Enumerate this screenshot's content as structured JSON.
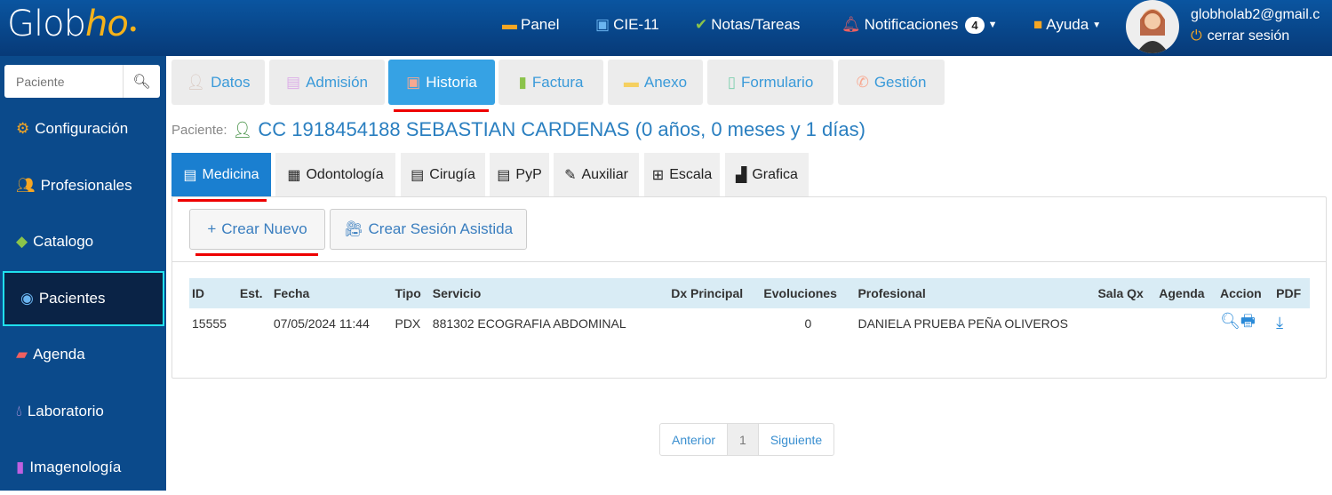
{
  "header": {
    "logo_main": "Glob",
    "logo_accent": "ho",
    "nav": [
      {
        "label": "Panel",
        "icon": "monitor-icon"
      },
      {
        "label": "CIE-11",
        "icon": "cie-icon"
      },
      {
        "label": "Notas/Tareas",
        "icon": "check-circle-icon"
      },
      {
        "label": "Notificaciones",
        "icon": "bell-icon",
        "badge": "4"
      },
      {
        "label": "Ayuda",
        "icon": "comment-icon"
      }
    ],
    "user_email": "globholab2@gmail.c",
    "logout": "cerrar sesión"
  },
  "sidebar": {
    "search_placeholder": "Paciente",
    "items": [
      {
        "label": "Configuración",
        "icon": "gear-icon"
      },
      {
        "label": "Profesionales",
        "icon": "users-icon"
      },
      {
        "label": "Catalogo",
        "icon": "tag-icon"
      },
      {
        "label": "Pacientes",
        "icon": "user-circle-icon"
      },
      {
        "label": "Agenda",
        "icon": "wallet-icon"
      },
      {
        "label": "Laboratorio",
        "icon": "drop-icon"
      },
      {
        "label": "Imagenología",
        "icon": "file-icon"
      }
    ]
  },
  "tabs": [
    "Datos",
    "Admisión",
    "Historia",
    "Factura",
    "Anexo",
    "Formulario",
    "Gestión"
  ],
  "patient": {
    "label": "Paciente:",
    "value": "CC 1918454188 SEBASTIAN CARDENAS (0 años, 0 meses y 1 días)"
  },
  "subtabs": [
    "Medicina",
    "Odontología",
    "Cirugía",
    "PyP",
    "Auxiliar",
    "Escala",
    "Grafica"
  ],
  "buttons": {
    "create": "Crear Nuevo",
    "session": "Crear Sesión Asistida"
  },
  "table": {
    "headers": [
      "ID",
      "Est.",
      "Fecha",
      "Tipo",
      "Servicio",
      "Dx Principal",
      "Evoluciones",
      "Profesional",
      "Sala Qx",
      "Agenda",
      "Accion",
      "PDF"
    ],
    "rows": [
      [
        "15555",
        "",
        "07/05/2024 11:44",
        "PDX",
        "881302 ECOGRAFIA ABDOMINAL",
        "",
        "0",
        "DANIELA PRUEBA PEÑA OLIVEROS",
        "",
        "",
        "",
        ""
      ]
    ]
  },
  "pagination": {
    "prev": "Anterior",
    "page": "1",
    "next": "Siguiente"
  }
}
